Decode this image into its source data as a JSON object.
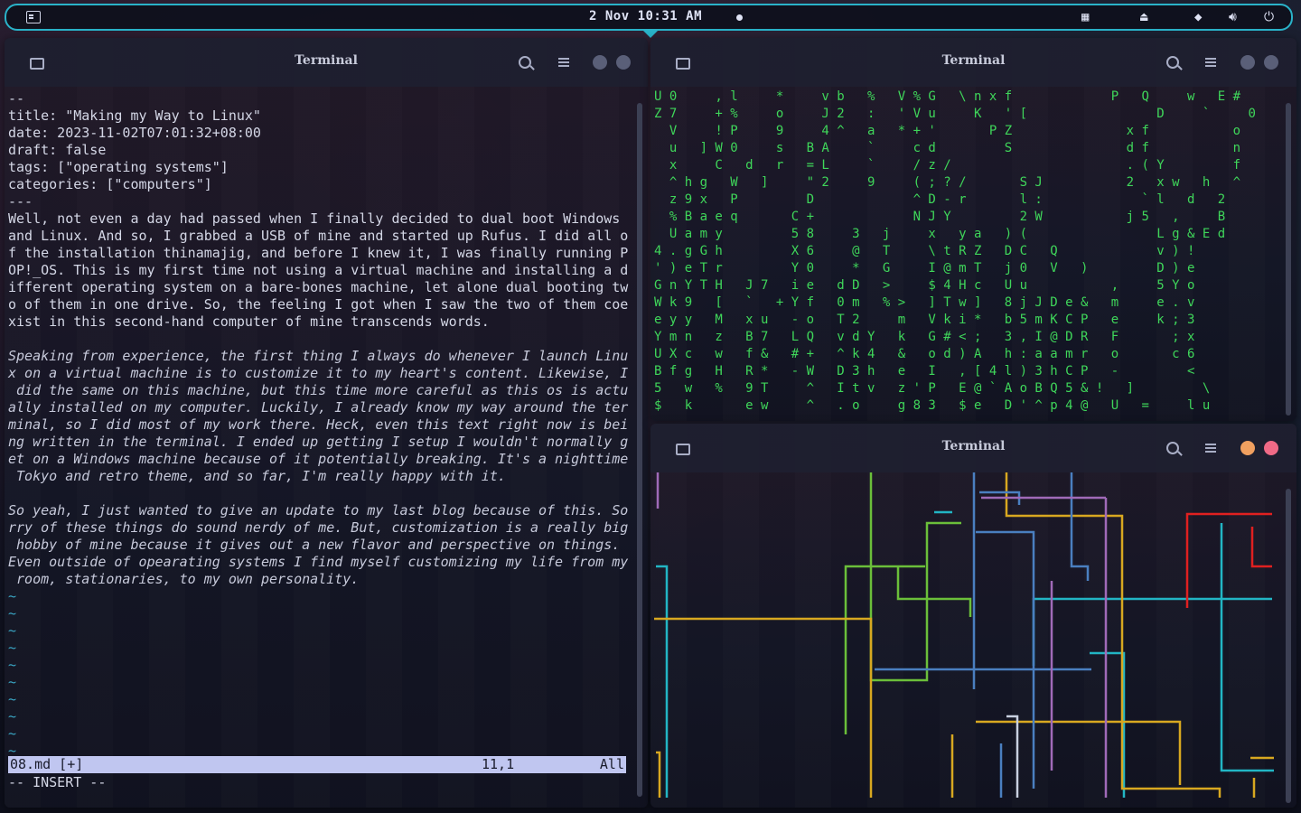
{
  "topbar": {
    "clock": "2 Nov 10:31 AM",
    "tray_icons": [
      "layout-icon",
      "eject-icon",
      "wifi-icon",
      "volume-icon",
      "power-icon"
    ]
  },
  "windows": {
    "editor": {
      "title": "Terminal",
      "lines": [
        "--",
        "title: \"Making my Way to Linux\"",
        "date: 2023-11-02T07:01:32+08:00",
        "draft: false",
        "tags: [\"operating systems\"]",
        "categories: [\"computers\"]",
        "---",
        "Well, not even a day had passed when I finally decided to dual boot Windows",
        "and Linux. And so, I grabbed a USB of mine and started up Rufus. I did all o",
        "f the installation thinamajig, and before I knew it, I was finally running P",
        "OP!_OS. This is my first time not using a virtual machine and installing a d",
        "ifferent operating system on a bare-bones machine, let alone dual booting tw",
        "o of them in one drive. So, the feeling I got when I saw the two of them coe",
        "xist in this second-hand computer of mine transcends words.",
        "",
        "Speaking from experience, the first thing I always do whenever I launch Linu",
        "x on a virtual machine is to customize it to my heart's content. Likewise, I",
        " did the same on this machine, but this time more careful as this os is actu",
        "ally installed on my computer. Luckily, I already know my way around the ter",
        "minal, so I did most of my work there. Heck, even this text right now is bei",
        "ng written in the terminal. I ended up getting I setup I wouldn't normally g",
        "et on a Windows machine because of it potentially breaking. It's a nighttime",
        " Tokyo and retro theme, and so far, I'm really happy with it.",
        "",
        "So yeah, I just wanted to give an update to my last blog because of this. So",
        "rry of these things do sound nerdy of me. But, customization is a really big",
        " hobby of mine because it gives out a new flavor and perspective on things.",
        "Even outside of opearating systems I find myself customizing my life from my",
        " room, stationaries, to my own personality."
      ],
      "tildes": [
        "~",
        "~",
        "~",
        "~",
        "~",
        "~",
        "~",
        "~",
        "~",
        "~"
      ],
      "status_file": "08.md [+]",
      "status_pos": "11,1",
      "status_all": "All",
      "mode": "-- INSERT --"
    },
    "matrix": {
      "title": "Terminal",
      "rows": [
        "U 0     , l     *     v b   %   V % G   \\ n x f             P   Q     w   E #",
        "Z 7     + %     o     J 2   :   ' V u     K   ' [                 D     `     0",
        "  V     ! P     9     4 ^   a   * + '       P Z               x f           o",
        "  u   ] W 0     s   B A     `     c d         S               d f           n",
        "  x     C   d   r   = L     `     / z /                       . ( Y         f",
        "  ^ h g   W   ]     \" 2     9     ( ; ? /       S J           2   x w   h   ^",
        "  z 9 x   P         D             ^ D - r       l :             ` l   d   2",
        "  % B a e q       C +             N J Y         2 W           j 5   ,     B",
        "  U a m y         5 8     3   j     x   y a   ) (                 L g & E d",
        "4 . g G h         X 6     @   T     \\ t R Z   D C   Q             v ) !",
        "' ) e T r         Y 0     *   G     I @ m T   j 0   V   )         D ) e",
        "G n Y T H   J 7   i e   d D   >     $ 4 H c   U u           ,     5 Y o",
        "W k 9   [   `   + Y f   0 m   % >   ] T w ]   8 j J D e &   m     e . v",
        "e y y   M   x u   - o   T 2     m   V k i *   b 5 m K C P   e     k ; 3",
        "Y m n   z   B 7   L Q   v d Y   k   G # < ;   3 , I @ D R   F       ; x",
        "U X c   w   f &   # +   ^ k 4   &   o d ) A   h : a a m r   o       c 6",
        "B f g   H   R *   - W   D 3 h   e   I   , [ 4 l ) 3 h C P   -         <",
        "5   w   %   9 T     ^   I t v   z ' P   E @ ` A o B Q 5 & !   ]         \\",
        "$   k       e w     ^   . o     g 8 3   $ e   D ' ^ p 4 @   U   =     l u"
      ]
    },
    "pipes": {
      "title": "Terminal"
    }
  },
  "colors": {
    "accent": "#2ab3c9",
    "status_bg": "#c0c6f0",
    "matrix_green": "#3fd65a",
    "btn_orange": "#f0a060",
    "btn_red": "#f06a86",
    "btn_gray": "#5a5f78"
  }
}
